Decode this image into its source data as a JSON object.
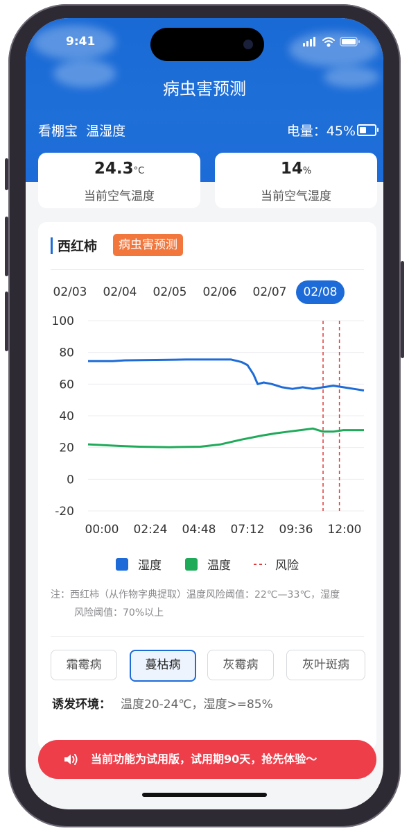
{
  "status": {
    "time": "9:41"
  },
  "header": {
    "title": "病虫害预测",
    "device": "看棚宝",
    "device_mode": "温湿度",
    "battery_label": "电量：",
    "battery_value": "45%",
    "battery_level": 0.45
  },
  "cards": [
    {
      "value": "24.3",
      "unit": "°C",
      "label": "当前空气温度"
    },
    {
      "value": "14",
      "unit": "%",
      "label": "当前空气湿度"
    }
  ],
  "crop": {
    "name": "西红柿",
    "tag": "病虫害预测"
  },
  "dates": [
    "02/03",
    "02/04",
    "02/05",
    "02/06",
    "02/07",
    "02/08"
  ],
  "selected_date": "02/08",
  "chart_data": {
    "type": "line",
    "x_ticks": [
      "00:00",
      "02:24",
      "04:48",
      "07:12",
      "09:36",
      "12:00"
    ],
    "y_ticks": [
      100,
      80,
      60,
      40,
      20,
      0,
      -20
    ],
    "ylim": [
      -20,
      100
    ],
    "xlim_hours": [
      0,
      13.5
    ],
    "grid": true,
    "legend_position": "bottom",
    "series": [
      {
        "name": "湿度",
        "color": "#1c6bd8",
        "x": [
          0,
          1.2,
          1.8,
          3.0,
          4.8,
          5.8,
          7.0,
          7.5,
          7.8,
          8.1,
          8.3,
          8.6,
          9.0,
          9.5,
          10.0,
          10.5,
          11.0,
          11.5,
          12.0,
          12.5,
          13.0,
          13.5
        ],
        "y": [
          74.5,
          74.5,
          75,
          75.2,
          75.5,
          75.5,
          75.5,
          74,
          72,
          66,
          60,
          61,
          60,
          58,
          57,
          58,
          57,
          58,
          59,
          58,
          57,
          56
        ]
      },
      {
        "name": "温度",
        "color": "#1faa5a",
        "x": [
          0,
          1.5,
          2.5,
          4.0,
          5.5,
          6.5,
          7.5,
          8.5,
          9.2,
          9.8,
          10.4,
          11.0,
          11.5,
          12.0,
          12.5,
          13.0,
          13.5
        ],
        "y": [
          22,
          21,
          20.5,
          20.2,
          20.5,
          22,
          25,
          27.5,
          29,
          30,
          31,
          32,
          30,
          30,
          31,
          31,
          31
        ]
      }
    ],
    "risk_marker": {
      "name": "风险",
      "color": "#e03b3b",
      "x": [
        11.5,
        12.3
      ]
    }
  },
  "note": {
    "line1": "注：西红柿（从作物字典提取）温度风险阈值：22℃—33℃，湿度",
    "line2": "风险阈值：70%以上"
  },
  "diseases": [
    "霜霉病",
    "蔓枯病",
    "灰霉病",
    "灰叶斑病"
  ],
  "selected_disease": "蔓枯病",
  "environment": {
    "label": "诱发环境：",
    "value": "温度20-24℃，湿度>=85%"
  },
  "banner": {
    "text": "当前功能为试用版，试用期90天，抢先体验～",
    "icon": "speaker-icon"
  }
}
